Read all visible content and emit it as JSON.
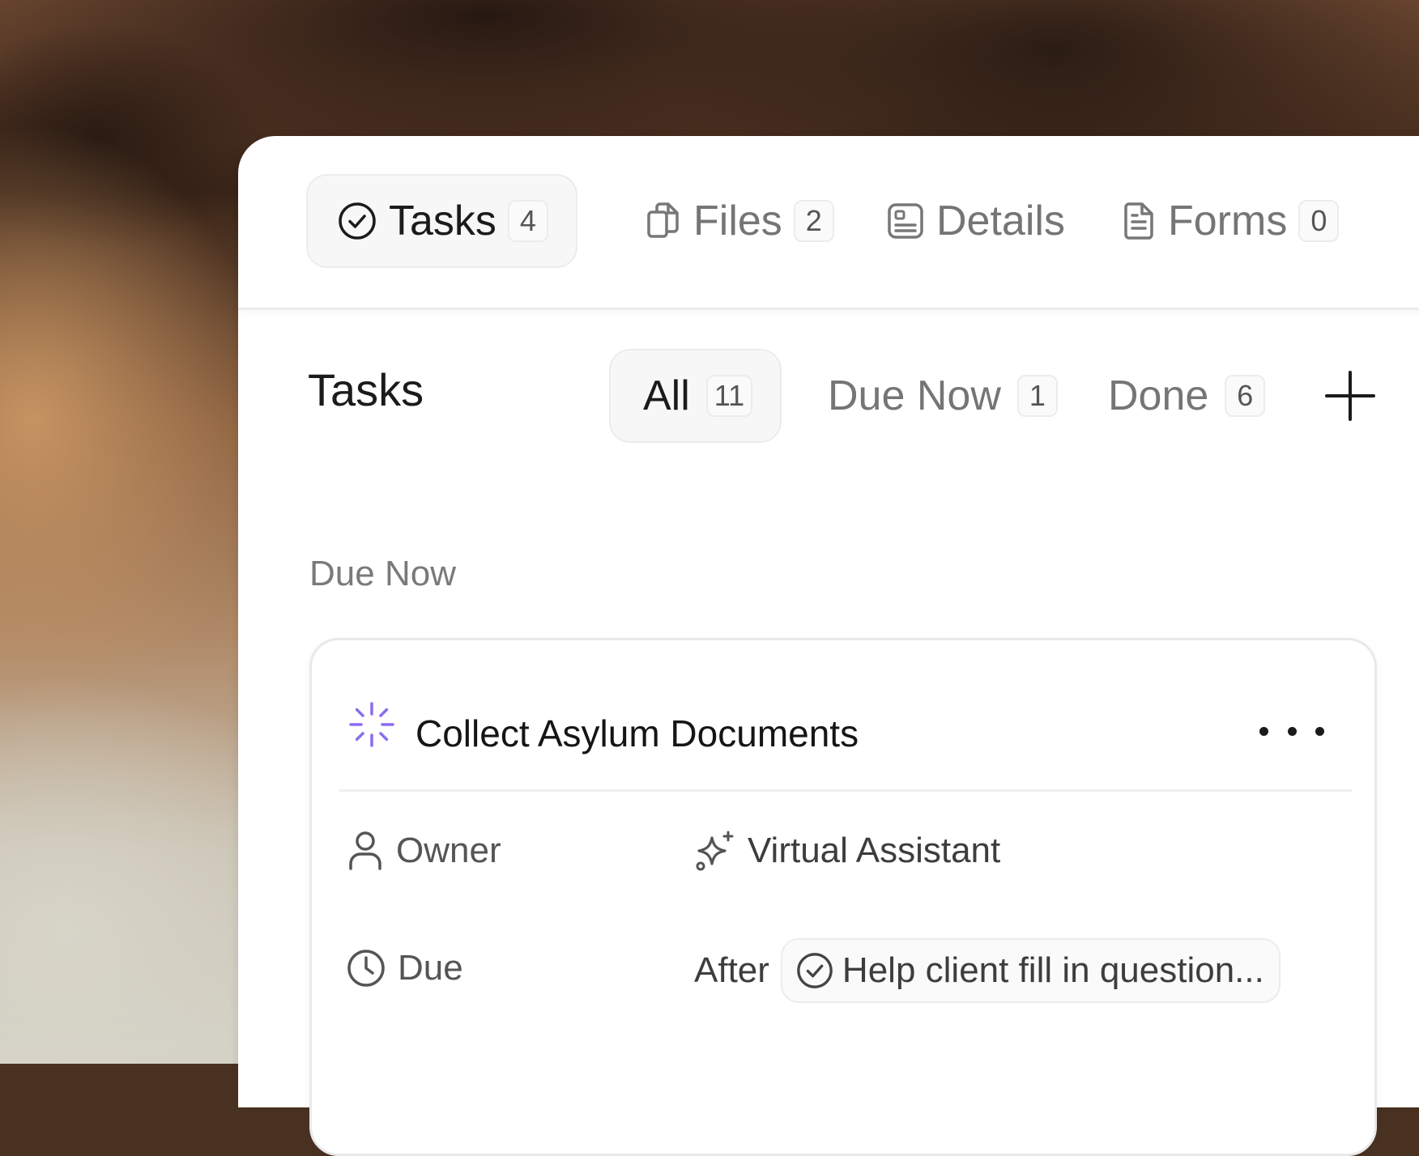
{
  "top_tabs": [
    {
      "label": "Tasks",
      "count": "4",
      "icon": "check-circle-icon",
      "active": true
    },
    {
      "label": "Files",
      "count": "2",
      "icon": "files-icon",
      "active": false
    },
    {
      "label": "Details",
      "icon": "details-icon",
      "active": false
    },
    {
      "label": "Forms",
      "count": "0",
      "icon": "document-icon",
      "active": false
    }
  ],
  "tasks_header": {
    "title": "Tasks",
    "filters": [
      {
        "label": "All",
        "count": "11",
        "active": true
      },
      {
        "label": "Due Now",
        "count": "1",
        "active": false
      },
      {
        "label": "Done",
        "count": "6",
        "active": false
      }
    ],
    "add_icon": "plus-icon"
  },
  "section": {
    "label": "Due Now"
  },
  "task_card": {
    "status_icon": "loading-spinner-icon",
    "title": "Collect Asylum Documents",
    "menu_icon": "more-horizontal-icon",
    "owner": {
      "label": "Owner",
      "icon": "user-icon",
      "value": "Virtual Assistant",
      "value_icon": "sparkles-icon"
    },
    "due": {
      "label": "Due",
      "icon": "clock-icon",
      "prefix": "After",
      "dependency": "Help client fill in question...",
      "dependency_icon": "check-circle-icon"
    }
  },
  "colors": {
    "accent_purple": "#8b6cf0",
    "text_primary": "#1b1b1b",
    "text_muted": "#757575"
  }
}
